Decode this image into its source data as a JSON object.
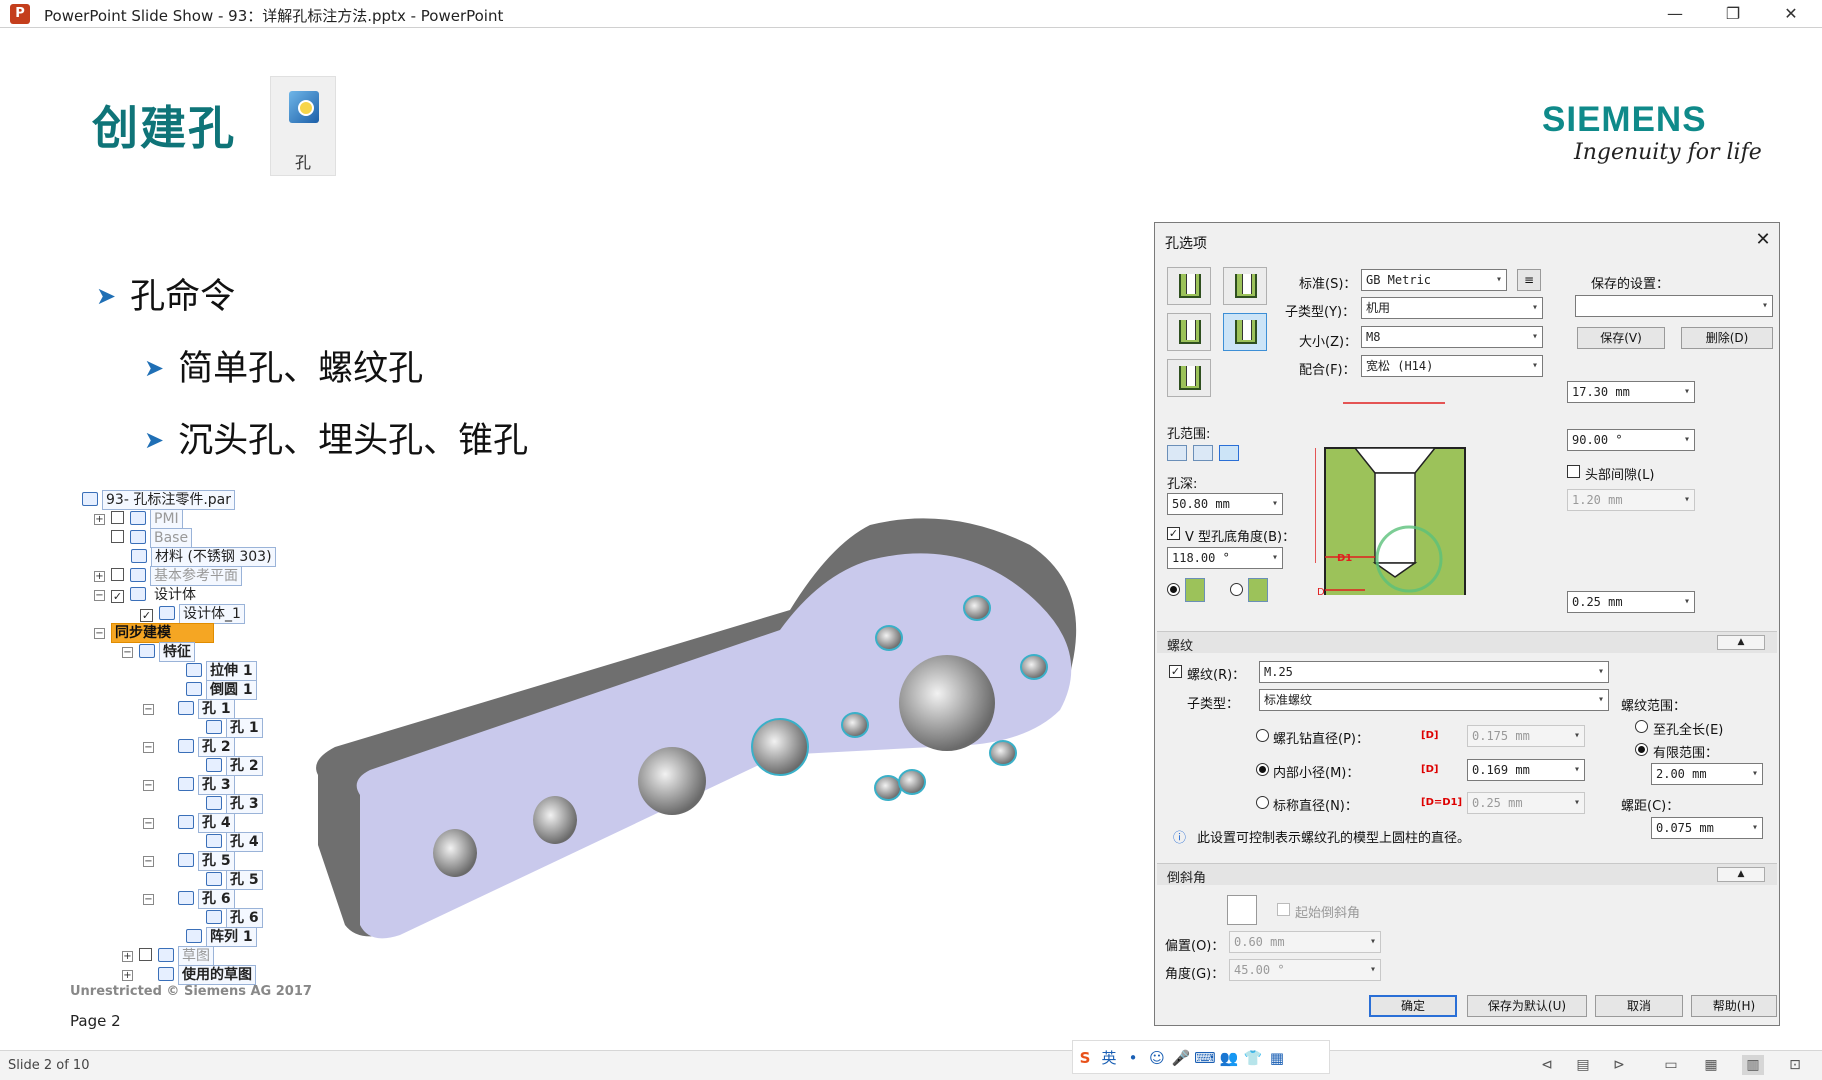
{
  "window": {
    "title": "PowerPoint Slide Show  -  93：详解孔标注方法.pptx - PowerPoint",
    "app_icon": "P",
    "minimize": "—",
    "restore": "❐",
    "close": "✕"
  },
  "slide": {
    "title": "创建孔",
    "ribbon_button_label": "孔",
    "brand": "SIEMENS",
    "tagline": "Ingenuity for life",
    "bullets": [
      {
        "text": "孔命令",
        "level": 1
      },
      {
        "text": "简单孔、螺纹孔",
        "level": 2
      },
      {
        "text": "沉头孔、埋头孔、锥孔",
        "level": 2
      }
    ],
    "footer": "Unrestricted © Siemens AG 2017",
    "page": "Page 2"
  },
  "tree": {
    "root": "93- 孔标注零件.par",
    "items": [
      {
        "label": "PMI"
      },
      {
        "label": "Base"
      },
      {
        "label": "材料 (不锈钢 303)"
      },
      {
        "label": "基本参考平面"
      },
      {
        "label": "设计体"
      },
      {
        "label": "设计体_1"
      },
      {
        "label": "同步建模"
      },
      {
        "label": "特征"
      },
      {
        "label": "拉伸 1"
      },
      {
        "label": "倒圆 1"
      },
      {
        "label": "孔 1"
      },
      {
        "label": "孔 1"
      },
      {
        "label": "孔 2"
      },
      {
        "label": "孔 2"
      },
      {
        "label": "孔 3"
      },
      {
        "label": "孔 3"
      },
      {
        "label": "孔 4"
      },
      {
        "label": "孔 4"
      },
      {
        "label": "孔 5"
      },
      {
        "label": "孔 5"
      },
      {
        "label": "孔 6"
      },
      {
        "label": "孔 6"
      },
      {
        "label": "阵列 1"
      },
      {
        "label": "草图"
      },
      {
        "label": "使用的草图"
      }
    ]
  },
  "dialog": {
    "title": "孔选项",
    "close": "✕",
    "standard_label": "标准(S)：",
    "standard_value": "GB Metric",
    "subtype_label": "子类型(Y)：",
    "subtype_value": "机用",
    "size_label": "大小(Z)：",
    "size_value": "M8",
    "fit_label": "配合(F)：",
    "fit_value": "宽松 (H14)",
    "saved_settings_label": "保存的设置：",
    "saved_settings_value": "",
    "save_btn": "保存(V)",
    "delete_btn": "删除(D)",
    "hole_extent_label": "孔范围:",
    "hole_depth_label": "孔深:",
    "hole_depth_value": "50.80 mm",
    "v_bottom_label": "V 型孔底角度(B)：",
    "v_bottom_value": "118.00 °",
    "dim_diameter": "17.30 mm",
    "dim_angle": "90.00 °",
    "head_clearance_label": "头部间隙(L)",
    "head_clearance_value": "1.20 mm",
    "dim_offset": "0.25 mm",
    "diagram_d1": "D1",
    "diagram_d": "D",
    "thread_section": "螺纹",
    "thread_label": "螺纹(R)：",
    "thread_value": "M.25",
    "thread_subtype_label": "子类型：",
    "thread_subtype_value": "标准螺纹",
    "thread_drill_label": "螺孔钻直径(P)：",
    "thread_drill_tag": "[D]",
    "thread_drill_value": "0.175 mm",
    "thread_minor_label": "内部小径(M)：",
    "thread_minor_tag": "[D]",
    "thread_minor_value": "0.169 mm",
    "thread_nominal_label": "标称直径(N)：",
    "thread_nominal_tag": "[D=D1]",
    "thread_nominal_value": "0.25 mm",
    "thread_info": "此设置可控制表示螺纹孔的模型上圆柱的直径。",
    "thread_range_label": "螺纹范围：",
    "thread_full_label": "至孔全长(E)",
    "thread_finite_label": "有限范围：",
    "thread_finite_value": "2.00 mm",
    "pitch_label": "螺距(C)：",
    "pitch_value": "0.075 mm",
    "chamfer_section": "倒斜角",
    "chamfer_start_label": "起始倒斜角",
    "offset_label": "偏置(O)：",
    "offset_value": "0.60 mm",
    "angle_label": "角度(G)：",
    "angle_value": "45.00 °",
    "ok_btn": "确定",
    "save_default_btn": "保存为默认(U)",
    "cancel_btn": "取消",
    "help_btn": "帮助(H)",
    "collapse_glyph": "▲"
  },
  "statusbar": {
    "slide_count": "Slide 2 of 10",
    "ime": [
      "S",
      "英",
      "•",
      "☺",
      "🎤",
      "⌨",
      "👥",
      "👕",
      "▦"
    ]
  },
  "colors": {
    "title_teal": "#0f7478",
    "bullet_arrow": "#1f6fb5",
    "model_face": "#c9c9ec",
    "model_side": "#6f6f6f",
    "hole_fill": "#9cc25a",
    "dim_red": "#e02020",
    "selection_orange": "#f5a623"
  }
}
